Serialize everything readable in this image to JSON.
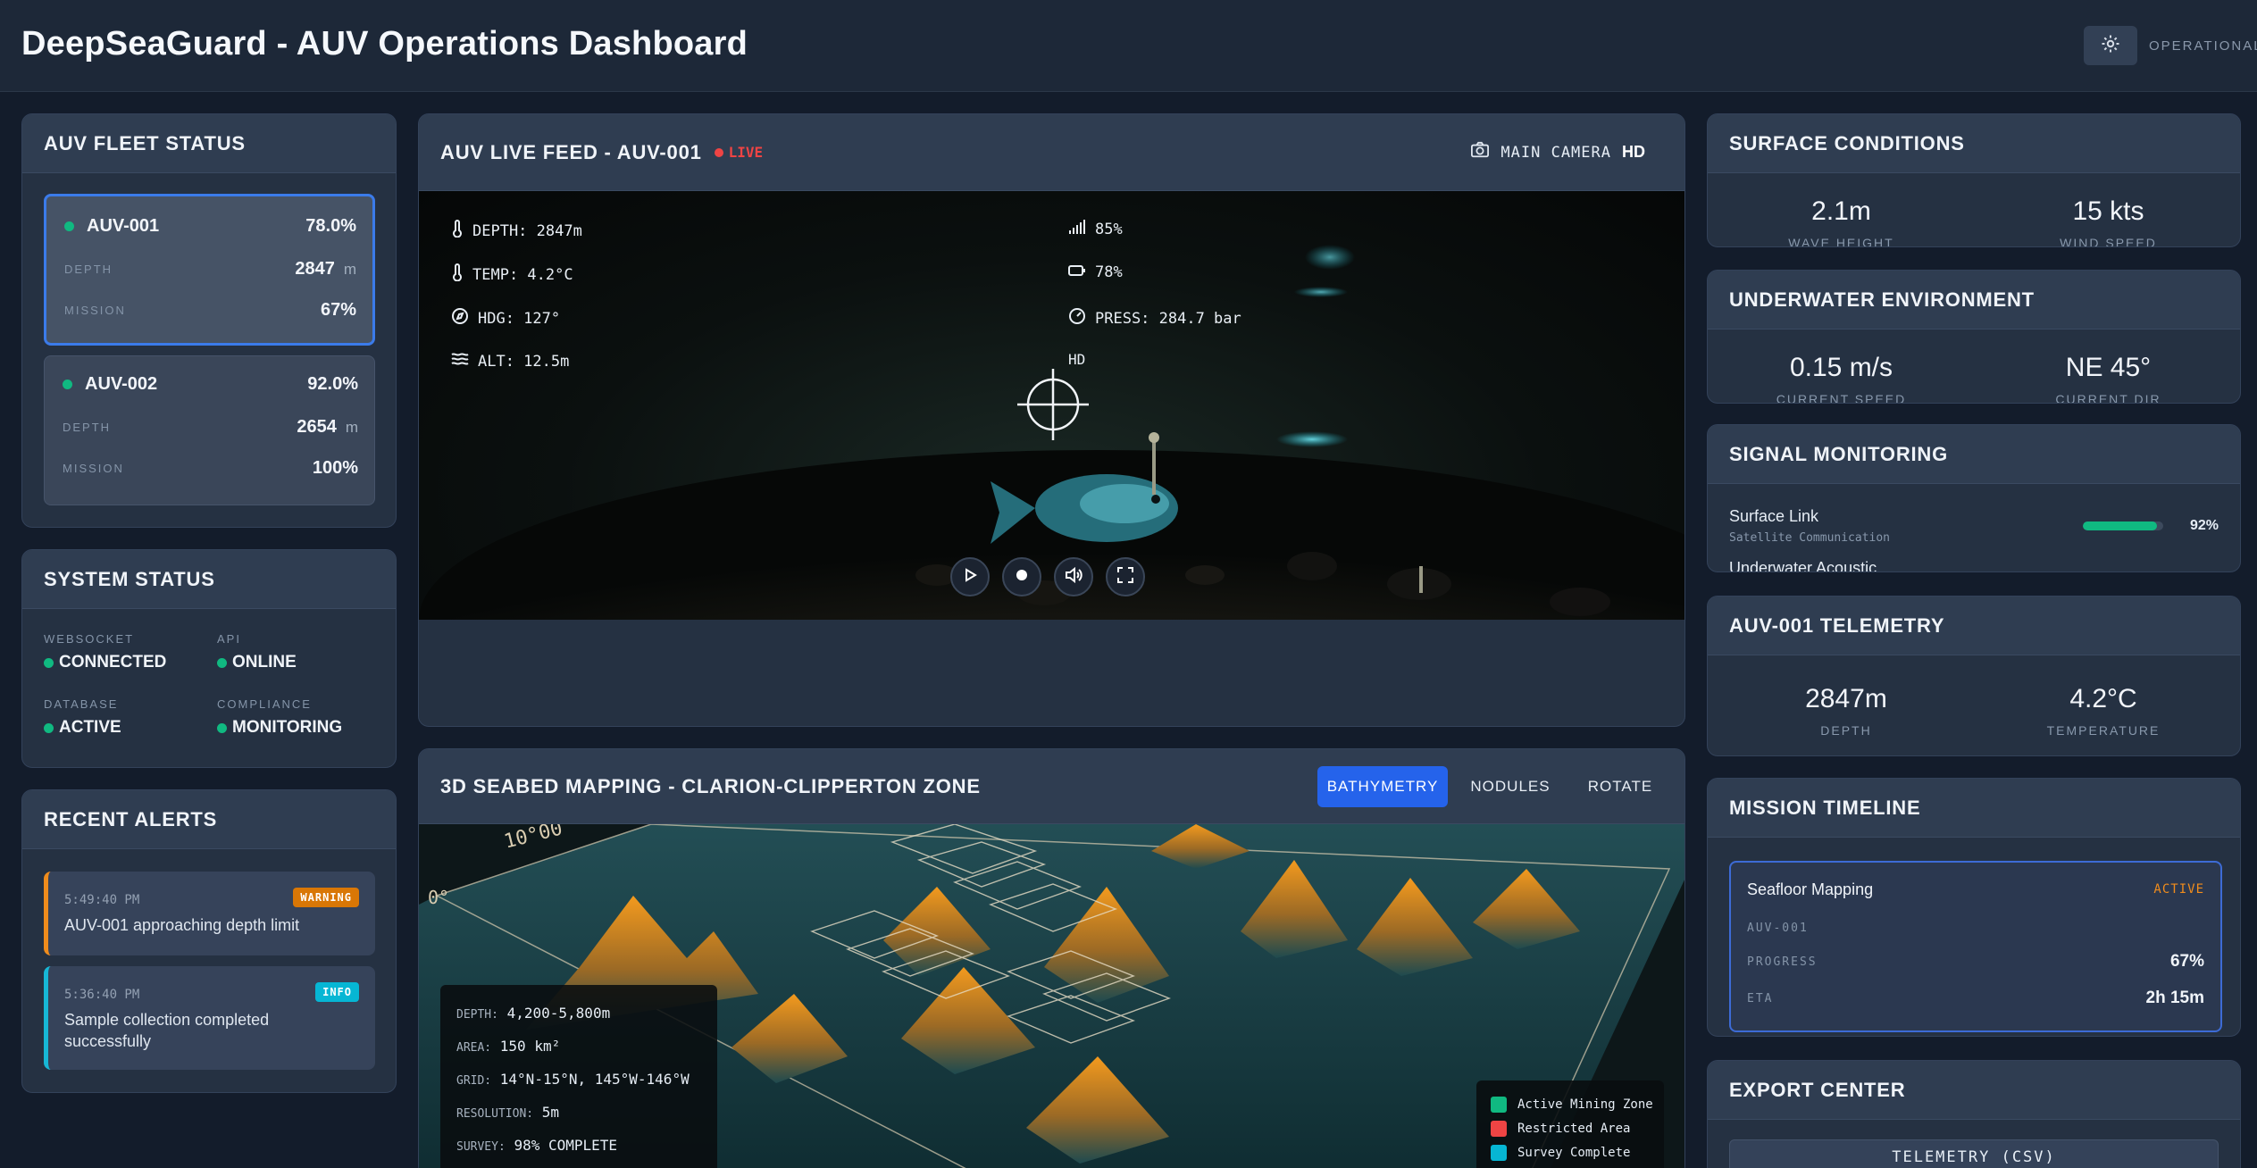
{
  "header": {
    "title": "DeepSeaGuard - AUV Operations Dashboard",
    "status": "OPERATIONAL"
  },
  "fleet": {
    "title": "AUV FLEET STATUS",
    "units": [
      {
        "name": "AUV-001",
        "battery": "78.0%",
        "depth_label": "DEPTH",
        "depth": "2847",
        "depth_unit": "m",
        "mission_label": "MISSION",
        "mission": "67%",
        "active": true
      },
      {
        "name": "AUV-002",
        "battery": "92.0%",
        "depth_label": "DEPTH",
        "depth": "2654",
        "depth_unit": "m",
        "mission_label": "MISSION",
        "mission": "100%",
        "active": false
      }
    ]
  },
  "system": {
    "title": "SYSTEM STATUS",
    "items": [
      {
        "label": "WEBSOCKET",
        "value": "CONNECTED"
      },
      {
        "label": "API",
        "value": "ONLINE"
      },
      {
        "label": "DATABASE",
        "value": "ACTIVE"
      },
      {
        "label": "COMPLIANCE",
        "value": "MONITORING"
      }
    ]
  },
  "alerts": {
    "title": "RECENT ALERTS",
    "items": [
      {
        "time": "5:49:40 PM",
        "badge": "WARNING",
        "message": "AUV-001 approaching depth limit"
      },
      {
        "time": "5:36:40 PM",
        "badge": "INFO",
        "message": "Sample collection completed successfully"
      }
    ]
  },
  "feed": {
    "title": "AUV LIVE FEED - AUV-001",
    "live": "LIVE",
    "camera": "MAIN CAMERA",
    "quality": "HD",
    "overlay": {
      "depth": "DEPTH: 2847m",
      "temp": "TEMP: 4.2°C",
      "heading": "HDG: 127°",
      "altitude": "ALT: 12.5m",
      "signal": "85%",
      "battery": "78%",
      "pressure": "PRESS: 284.7 bar",
      "hd": "HD"
    }
  },
  "seabed": {
    "title": "3D SEABED MAPPING - CLARION-CLIPPERTON ZONE",
    "tabs": [
      "BATHYMETRY",
      "NODULES",
      "ROTATE"
    ],
    "axis_label": "10°00",
    "axis_label_2": "0°",
    "info": [
      {
        "key": "DEPTH:",
        "value": "4,200-5,800m"
      },
      {
        "key": "AREA:",
        "value": "150 km²"
      },
      {
        "key": "GRID:",
        "value": "14°N-15°N, 145°W-146°W"
      },
      {
        "key": "RESOLUTION:",
        "value": "5m"
      },
      {
        "key": "SURVEY:",
        "value": "98% COMPLETE"
      }
    ],
    "legend": [
      {
        "label": "Active Mining Zone",
        "color": "#10b981"
      },
      {
        "label": "Restricted Area",
        "color": "#ef4444"
      },
      {
        "label": "Survey Complete",
        "color": "#06b6d4"
      }
    ]
  },
  "surface": {
    "title": "SURFACE CONDITIONS",
    "metrics": [
      {
        "value": "2.1m",
        "label": "WAVE HEIGHT"
      },
      {
        "value": "15 kts",
        "label": "WIND SPEED"
      }
    ]
  },
  "underwater": {
    "title": "UNDERWATER ENVIRONMENT",
    "metrics": [
      {
        "value": "0.15 m/s",
        "label": "CURRENT SPEED"
      },
      {
        "value": "NE 45°",
        "label": "CURRENT DIR"
      }
    ]
  },
  "signal": {
    "title": "SIGNAL MONITORING",
    "items": [
      {
        "name": "Surface Link",
        "sub": "Satellite Communication",
        "percent_label": "92%",
        "level": 0.92,
        "color": "#10b981"
      },
      {
        "name": "Underwater Acoustic",
        "sub": "",
        "percent_label": "",
        "level": 0,
        "color": "#10b981"
      }
    ]
  },
  "telemetry": {
    "title": "AUV-001 TELEMETRY",
    "metrics": [
      {
        "value": "2847m",
        "label": "DEPTH"
      },
      {
        "value": "4.2°C",
        "label": "TEMPERATURE"
      }
    ]
  },
  "timeline": {
    "title": "MISSION TIMELINE",
    "mission": "Seafloor Mapping",
    "status": "ACTIVE",
    "unit": "AUV-001",
    "progress_label": "PROGRESS",
    "progress": "67%",
    "eta_label": "ETA",
    "eta": "2h 15m"
  },
  "export": {
    "title": "EXPORT CENTER",
    "button": "TELEMETRY (CSV)"
  },
  "colors": {
    "accent": "#2563eb",
    "success": "#10b981",
    "warning": "#d97706",
    "info": "#06b6d4",
    "live": "#ef4444"
  }
}
